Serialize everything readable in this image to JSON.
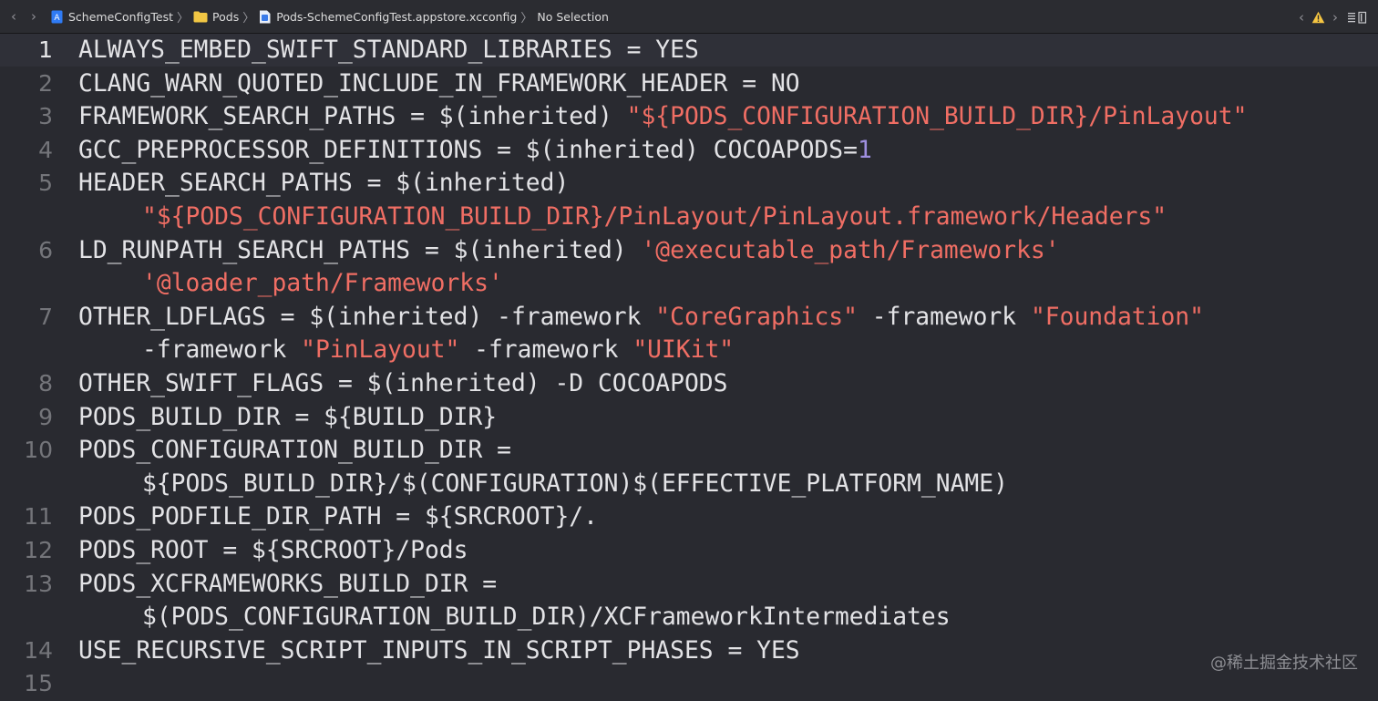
{
  "breadcrumb": {
    "items": [
      {
        "label": "SchemeConfigTest",
        "icon": "project-icon"
      },
      {
        "label": "Pods",
        "icon": "folder-icon"
      },
      {
        "label": "Pods-SchemeConfigTest.appstore.xcconfig",
        "icon": "xcconfig-file-icon"
      },
      {
        "label": "No Selection",
        "icon": ""
      }
    ],
    "separator": "〉"
  },
  "nav": {
    "back": "‹",
    "forward": "›"
  },
  "colors": {
    "background": "#292a30",
    "text": "#e3e3e6",
    "string": "#f06e64",
    "number": "#9f8fe0",
    "line_number": "#74757a",
    "warning": "#f5c542"
  },
  "editor": {
    "current_line": 1,
    "lines": [
      {
        "n": "1",
        "parts": [
          {
            "t": "ALWAYS_EMBED_SWIFT_STANDARD_LIBRARIES = YES"
          }
        ]
      },
      {
        "n": "2",
        "parts": [
          {
            "t": "CLANG_WARN_QUOTED_INCLUDE_IN_FRAMEWORK_HEADER = NO"
          }
        ]
      },
      {
        "n": "3",
        "parts": [
          {
            "t": "FRAMEWORK_SEARCH_PATHS = $(inherited) "
          },
          {
            "t": "\"${PODS_CONFIGURATION_BUILD_DIR}/PinLayout\"",
            "k": "str"
          }
        ]
      },
      {
        "n": "4",
        "parts": [
          {
            "t": "GCC_PREPROCESSOR_DEFINITIONS = $(inherited) COCOAPODS="
          },
          {
            "t": "1",
            "k": "num"
          }
        ]
      },
      {
        "n": "5",
        "parts": [
          {
            "t": "HEADER_SEARCH_PATHS = $(inherited)"
          }
        ]
      },
      {
        "n": "",
        "cont": true,
        "parts": [
          {
            "t": "\"${PODS_CONFIGURATION_BUILD_DIR}/PinLayout/PinLayout.framework/Headers\"",
            "k": "str"
          }
        ]
      },
      {
        "n": "6",
        "parts": [
          {
            "t": "LD_RUNPATH_SEARCH_PATHS = $(inherited) "
          },
          {
            "t": "'@executable_path/Frameworks'",
            "k": "str"
          }
        ]
      },
      {
        "n": "",
        "cont": true,
        "parts": [
          {
            "t": "'@loader_path/Frameworks'",
            "k": "str"
          }
        ]
      },
      {
        "n": "7",
        "parts": [
          {
            "t": "OTHER_LDFLAGS = $(inherited) -framework "
          },
          {
            "t": "\"CoreGraphics\"",
            "k": "str"
          },
          {
            "t": " -framework "
          },
          {
            "t": "\"Foundation\"",
            "k": "str"
          }
        ]
      },
      {
        "n": "",
        "cont": true,
        "parts": [
          {
            "t": "-framework "
          },
          {
            "t": "\"PinLayout\"",
            "k": "str"
          },
          {
            "t": " -framework "
          },
          {
            "t": "\"UIKit\"",
            "k": "str"
          }
        ]
      },
      {
        "n": "8",
        "parts": [
          {
            "t": "OTHER_SWIFT_FLAGS = $(inherited) -D COCOAPODS"
          }
        ]
      },
      {
        "n": "9",
        "parts": [
          {
            "t": "PODS_BUILD_DIR = ${BUILD_DIR}"
          }
        ]
      },
      {
        "n": "10",
        "parts": [
          {
            "t": "PODS_CONFIGURATION_BUILD_DIR ="
          }
        ]
      },
      {
        "n": "",
        "cont": true,
        "parts": [
          {
            "t": "${PODS_BUILD_DIR}/$(CONFIGURATION)$(EFFECTIVE_PLATFORM_NAME)"
          }
        ]
      },
      {
        "n": "11",
        "parts": [
          {
            "t": "PODS_PODFILE_DIR_PATH = ${SRCROOT}/."
          }
        ]
      },
      {
        "n": "12",
        "parts": [
          {
            "t": "PODS_ROOT = ${SRCROOT}/Pods"
          }
        ]
      },
      {
        "n": "13",
        "parts": [
          {
            "t": "PODS_XCFRAMEWORKS_BUILD_DIR ="
          }
        ]
      },
      {
        "n": "",
        "cont": true,
        "parts": [
          {
            "t": "$(PODS_CONFIGURATION_BUILD_DIR)/XCFrameworkIntermediates"
          }
        ]
      },
      {
        "n": "14",
        "parts": [
          {
            "t": "USE_RECURSIVE_SCRIPT_INPUTS_IN_SCRIPT_PHASES = YES"
          }
        ]
      },
      {
        "n": "15",
        "parts": []
      }
    ]
  },
  "watermark": "@稀土掘金技术社区"
}
